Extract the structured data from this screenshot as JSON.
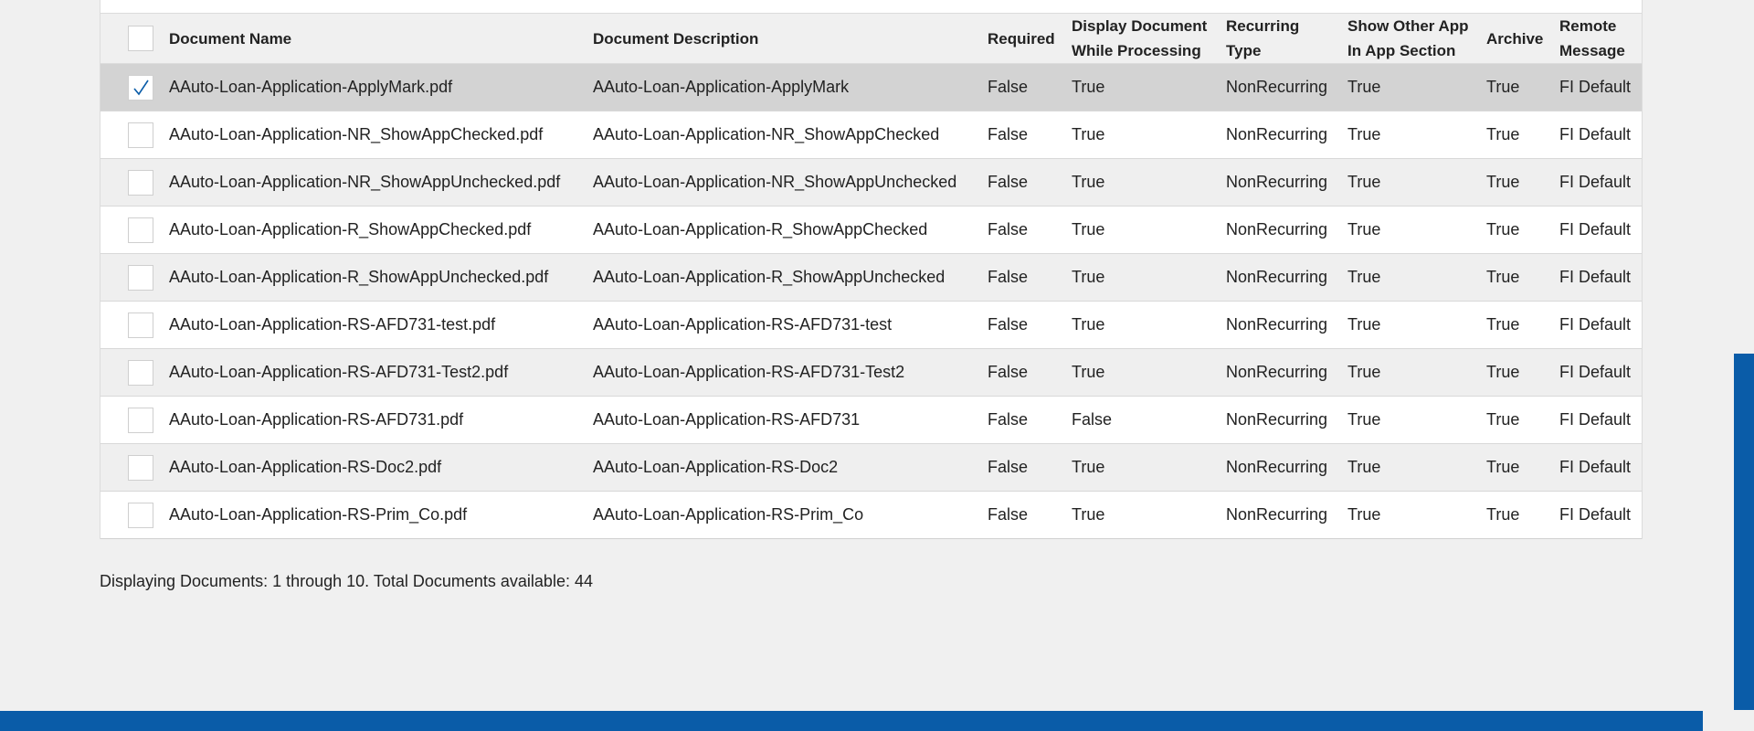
{
  "table": {
    "headers": {
      "document_name": "Document Name",
      "document_description": "Document Description",
      "required": "Required",
      "display_while_processing": [
        "Display Document",
        "While Processing"
      ],
      "recurring_type": [
        "Recurring",
        "Type"
      ],
      "show_other_app": [
        "Show Other App",
        "In App Section"
      ],
      "archive": "Archive",
      "remote_message": [
        "Remote",
        "Message"
      ]
    },
    "rows": [
      {
        "selected": true,
        "name": "AAuto-Loan-Application-ApplyMark.pdf",
        "description": "AAuto-Loan-Application-ApplyMark",
        "required": "False",
        "display": "True",
        "recurring": "NonRecurring",
        "show_other": "True",
        "archive": "True",
        "remote": "FI Default"
      },
      {
        "selected": false,
        "name": "AAuto-Loan-Application-NR_ShowAppChecked.pdf",
        "description": "AAuto-Loan-Application-NR_ShowAppChecked",
        "required": "False",
        "display": "True",
        "recurring": "NonRecurring",
        "show_other": "True",
        "archive": "True",
        "remote": "FI Default"
      },
      {
        "selected": false,
        "name": "AAuto-Loan-Application-NR_ShowAppUnchecked.pdf",
        "description": "AAuto-Loan-Application-NR_ShowAppUnchecked",
        "required": "False",
        "display": "True",
        "recurring": "NonRecurring",
        "show_other": "True",
        "archive": "True",
        "remote": "FI Default"
      },
      {
        "selected": false,
        "name": "AAuto-Loan-Application-R_ShowAppChecked.pdf",
        "description": "AAuto-Loan-Application-R_ShowAppChecked",
        "required": "False",
        "display": "True",
        "recurring": "NonRecurring",
        "show_other": "True",
        "archive": "True",
        "remote": "FI Default"
      },
      {
        "selected": false,
        "name": "AAuto-Loan-Application-R_ShowAppUnchecked.pdf",
        "description": "AAuto-Loan-Application-R_ShowAppUnchecked",
        "required": "False",
        "display": "True",
        "recurring": "NonRecurring",
        "show_other": "True",
        "archive": "True",
        "remote": "FI Default"
      },
      {
        "selected": false,
        "name": "AAuto-Loan-Application-RS-AFD731-test.pdf",
        "description": "AAuto-Loan-Application-RS-AFD731-test",
        "required": "False",
        "display": "True",
        "recurring": "NonRecurring",
        "show_other": "True",
        "archive": "True",
        "remote": "FI Default"
      },
      {
        "selected": false,
        "name": "AAuto-Loan-Application-RS-AFD731-Test2.pdf",
        "description": "AAuto-Loan-Application-RS-AFD731-Test2",
        "required": "False",
        "display": "True",
        "recurring": "NonRecurring",
        "show_other": "True",
        "archive": "True",
        "remote": "FI Default"
      },
      {
        "selected": false,
        "name": "AAuto-Loan-Application-RS-AFD731.pdf",
        "description": "AAuto-Loan-Application-RS-AFD731",
        "required": "False",
        "display": "False",
        "recurring": "NonRecurring",
        "show_other": "True",
        "archive": "True",
        "remote": "FI Default"
      },
      {
        "selected": false,
        "name": "AAuto-Loan-Application-RS-Doc2.pdf",
        "description": "AAuto-Loan-Application-RS-Doc2",
        "required": "False",
        "display": "True",
        "recurring": "NonRecurring",
        "show_other": "True",
        "archive": "True",
        "remote": "FI Default"
      },
      {
        "selected": false,
        "name": "AAuto-Loan-Application-RS-Prim_Co.pdf",
        "description": "AAuto-Loan-Application-RS-Prim_Co",
        "required": "False",
        "display": "True",
        "recurring": "NonRecurring",
        "show_other": "True",
        "archive": "True",
        "remote": "FI Default"
      }
    ]
  },
  "footer": {
    "status": "Displaying Documents: 1 through 10. Total Documents available: 44"
  },
  "colors": {
    "accent": "#0a5ca8",
    "selected_row": "#d3d3d3",
    "check_mark": "#0a5ca8"
  }
}
